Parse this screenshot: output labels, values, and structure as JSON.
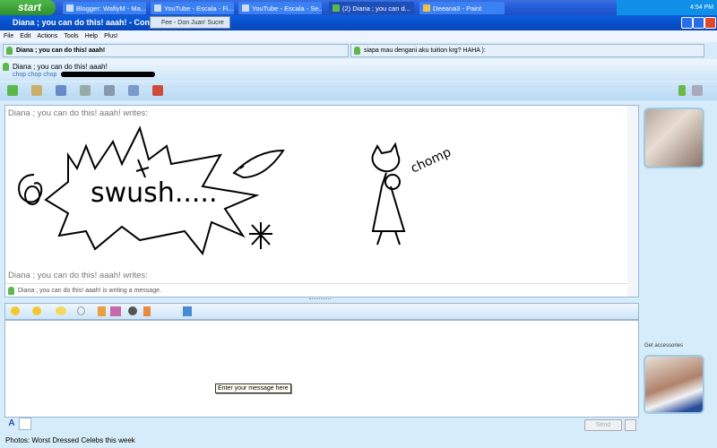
{
  "taskbar": {
    "start": "start",
    "tasks": [
      "Blogger: WafiyM - Ma...",
      "YouTube - Escala - Fi...",
      "YouTube - Escala - Se...",
      "(2) Diana ; you can d...",
      "Deeana3 - Paint"
    ],
    "active_index": 3,
    "clock": "4:54 PM"
  },
  "window": {
    "title": "Diana ; you can do this! aaah! - Convers",
    "tooltip": "Fee - Don Juan' Sucre"
  },
  "menu": [
    "File",
    "Edit",
    "Actions",
    "Tools",
    "Help",
    "Plus!"
  ],
  "tabs": [
    "Diana ; you can do this! aaah!",
    "siapa mau dengani aku tuition krg? HAHA ):"
  ],
  "contact": {
    "name": "Diana ; you can do this! aaah!",
    "message": "chop chop chop"
  },
  "conversation": {
    "writes_1": "Diana ; you can do this! aaah! writes:",
    "drawing_text": "swush.....",
    "drawing_text2": "chomp",
    "writes_2": "Diana ; you can do this! aaah! writes:",
    "typing": "Diana ; you can do this! aaah! is writing a message."
  },
  "input": {
    "hint": "Enter your message here",
    "send": "Send"
  },
  "sidebar": {
    "accessories": "Get accessories"
  },
  "status": "Photos: Worst Dressed Celebs this week"
}
